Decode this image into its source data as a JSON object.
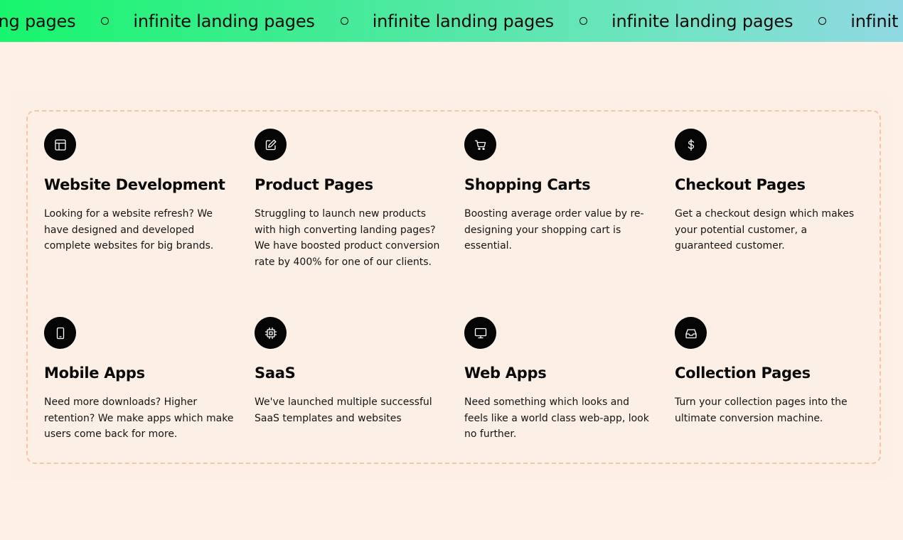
{
  "marquee": {
    "text": "infinite landing pages",
    "leading_fragment": "e landing pages",
    "trailing_fragment": "infinit",
    "separator_icon": "circle-outline-icon"
  },
  "services": [
    {
      "icon": "layout-icon",
      "title": "Website Development",
      "description": "Looking for a website refresh? We have designed and developed complete websites for big brands."
    },
    {
      "icon": "edit-icon",
      "title": "Product Pages",
      "description": "Struggling to launch new products with high converting landing pages? We have boosted product conversion rate by 400% for one of our clients."
    },
    {
      "icon": "shopping-cart-icon",
      "title": "Shopping Carts",
      "description": "Boosting average order value by re-designing your shopping cart is essential."
    },
    {
      "icon": "dollar-icon",
      "title": "Checkout Pages",
      "description": "Get a checkout design which makes your potential customer, a guaranteed customer."
    },
    {
      "icon": "smartphone-icon",
      "title": "Mobile Apps",
      "description": "Need more downloads? Higher retention? We make apps which make users come back for more."
    },
    {
      "icon": "chip-icon",
      "title": "SaaS",
      "description": "We've launched multiple successful SaaS templates and websites"
    },
    {
      "icon": "monitor-icon",
      "title": "Web Apps",
      "description": "Need something which looks and feels like a world class web-app, look no further."
    },
    {
      "icon": "inbox-icon",
      "title": "Collection Pages",
      "description": "Turn your collection pages into the ultimate conversion machine."
    }
  ],
  "colors": {
    "page_background": "#fdf0e6",
    "marquee_gradient_start": "#18f56d",
    "marquee_gradient_end": "#90d8e2",
    "frame_border": "#f6c5a5",
    "icon_background": "#050505",
    "text": "#111111"
  }
}
